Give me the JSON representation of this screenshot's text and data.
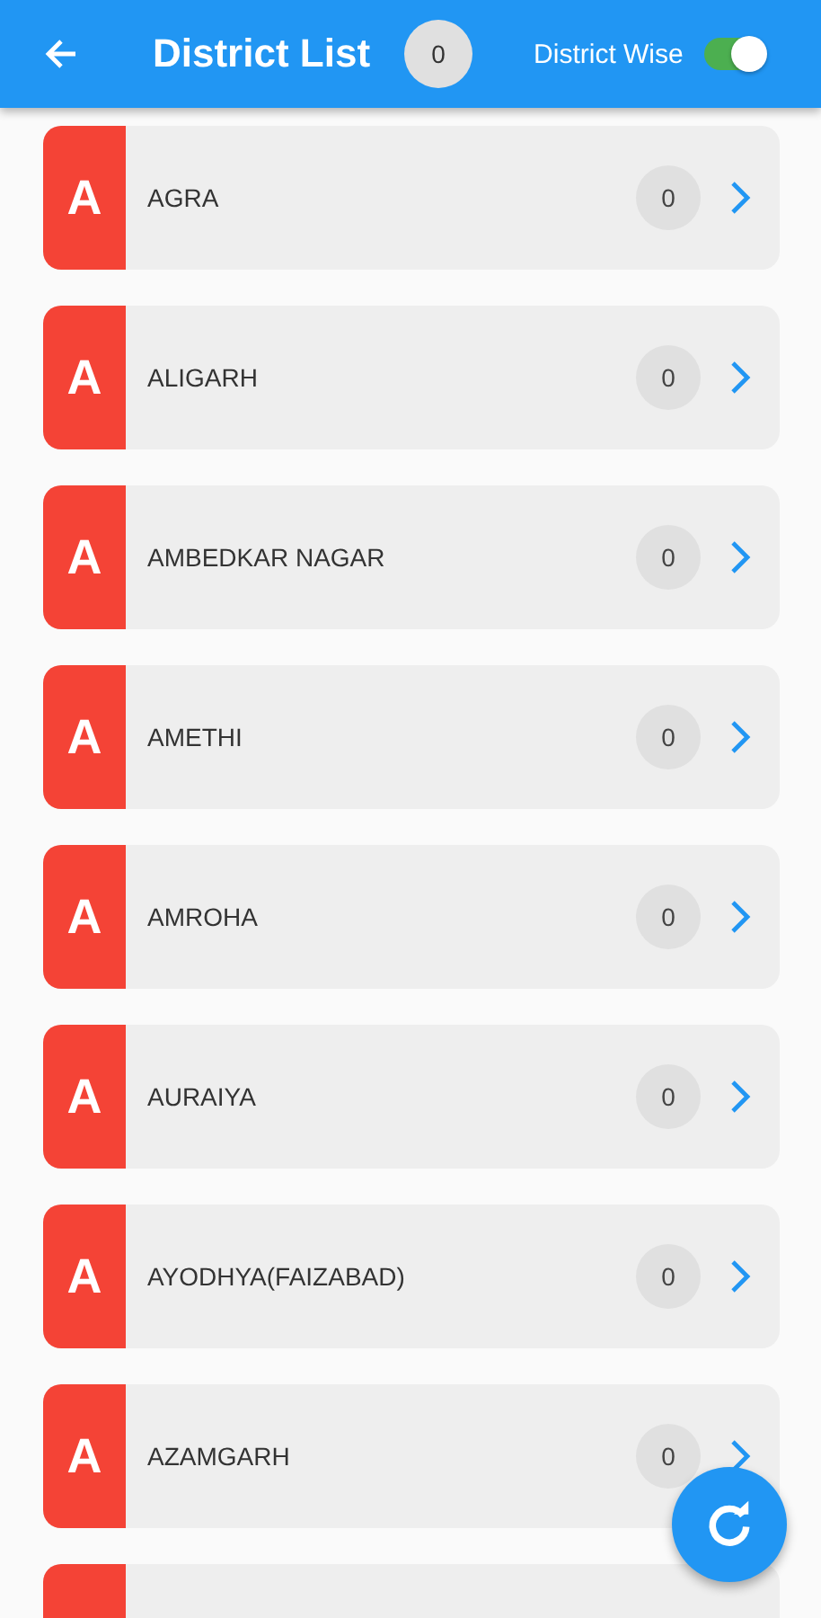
{
  "app_bar": {
    "title": "District List",
    "count": "0",
    "toggle_label": "District Wise",
    "toggle_on": true
  },
  "districts": [
    {
      "kind": "full",
      "letter": "A",
      "name": "AGRA",
      "count": "0"
    },
    {
      "kind": "full",
      "letter": "A",
      "name": "ALIGARH",
      "count": "0"
    },
    {
      "kind": "full",
      "letter": "A",
      "name": "AMBEDKAR NAGAR",
      "count": "0"
    },
    {
      "kind": "full",
      "letter": "A",
      "name": "AMETHI",
      "count": "0"
    },
    {
      "kind": "full",
      "letter": "A",
      "name": "AMROHA",
      "count": "0"
    },
    {
      "kind": "full",
      "letter": "A",
      "name": "AURAIYA",
      "count": "0"
    },
    {
      "kind": "full",
      "letter": "A",
      "name": "AYODHYA(FAIZABAD)",
      "count": "0"
    },
    {
      "kind": "full",
      "letter": "A",
      "name": "AZAMGARH",
      "count": "0"
    },
    {
      "kind": "cut"
    }
  ]
}
